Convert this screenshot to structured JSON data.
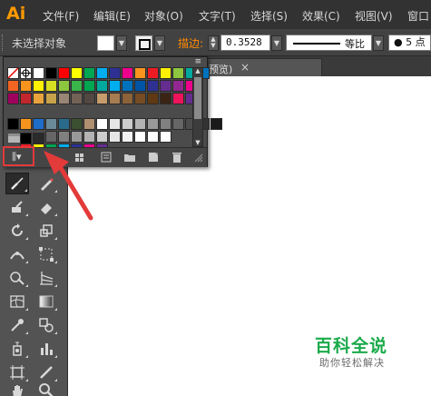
{
  "app": {
    "logo": "Ai",
    "accent": "#ff9a00"
  },
  "menu": [
    "文件(F)",
    "编辑(E)",
    "对象(O)",
    "文字(T)",
    "选择(S)",
    "效果(C)",
    "视图(V)",
    "窗口"
  ],
  "control_bar": {
    "selection_status": "未选择对象",
    "stroke_label": "描边:",
    "stroke_value": "0.3528",
    "profile_label": "等比",
    "brush_label": "5 点"
  },
  "doc_tab": {
    "label": "预览)",
    "close": "×"
  },
  "swatch_popup": {
    "menu_glyph": "≡",
    "library_button": "⫼▾",
    "scroll_up": "▲",
    "scroll_down": "▼"
  },
  "watermark": {
    "title": "百科全说",
    "subtitle": "助你轻松解决"
  },
  "colors": {
    "highlight": "#e33a3a",
    "watermark_green": "#1aaa4a",
    "row1": [
      "#ffffff",
      "#000000",
      "#ff0000",
      "#ffff00",
      "#00a651",
      "#00aeef",
      "#2e3192",
      "#ec008c",
      "#f7941d",
      "#ed1c24",
      "#fff200",
      "#8dc63f",
      "#00a99d",
      "#0072bc"
    ],
    "row2": [
      "#f26522",
      "#f7941d",
      "#fff200",
      "#d7df23",
      "#8dc63f",
      "#39b54a",
      "#00a651",
      "#00a99d",
      "#00aeef",
      "#0072bc",
      "#0054a6",
      "#2e3192",
      "#662d91",
      "#92278f",
      "#ec008c"
    ],
    "row3": [
      "#9e005d",
      "#c1272d",
      "#e8a33c",
      "#c8a24b",
      "#998675",
      "#736357",
      "#534741",
      "#c69c6d",
      "#a67c52",
      "#8c6239",
      "#754c24",
      "#603913",
      "#3c2415",
      "#ed145b",
      "#662d91"
    ],
    "row4": [
      "#ffffff",
      "#e6e6e6",
      "#cccccc",
      "#b3b3b3",
      "#999999",
      "#808080",
      "#666666",
      "#4d4d4d",
      "#333333",
      "#1a1a1a"
    ],
    "row5": [
      "#ed1c24",
      "#fff200",
      "#00a651",
      "#00aeef",
      "#2e3192",
      "#ec008c",
      "#662d91"
    ]
  }
}
